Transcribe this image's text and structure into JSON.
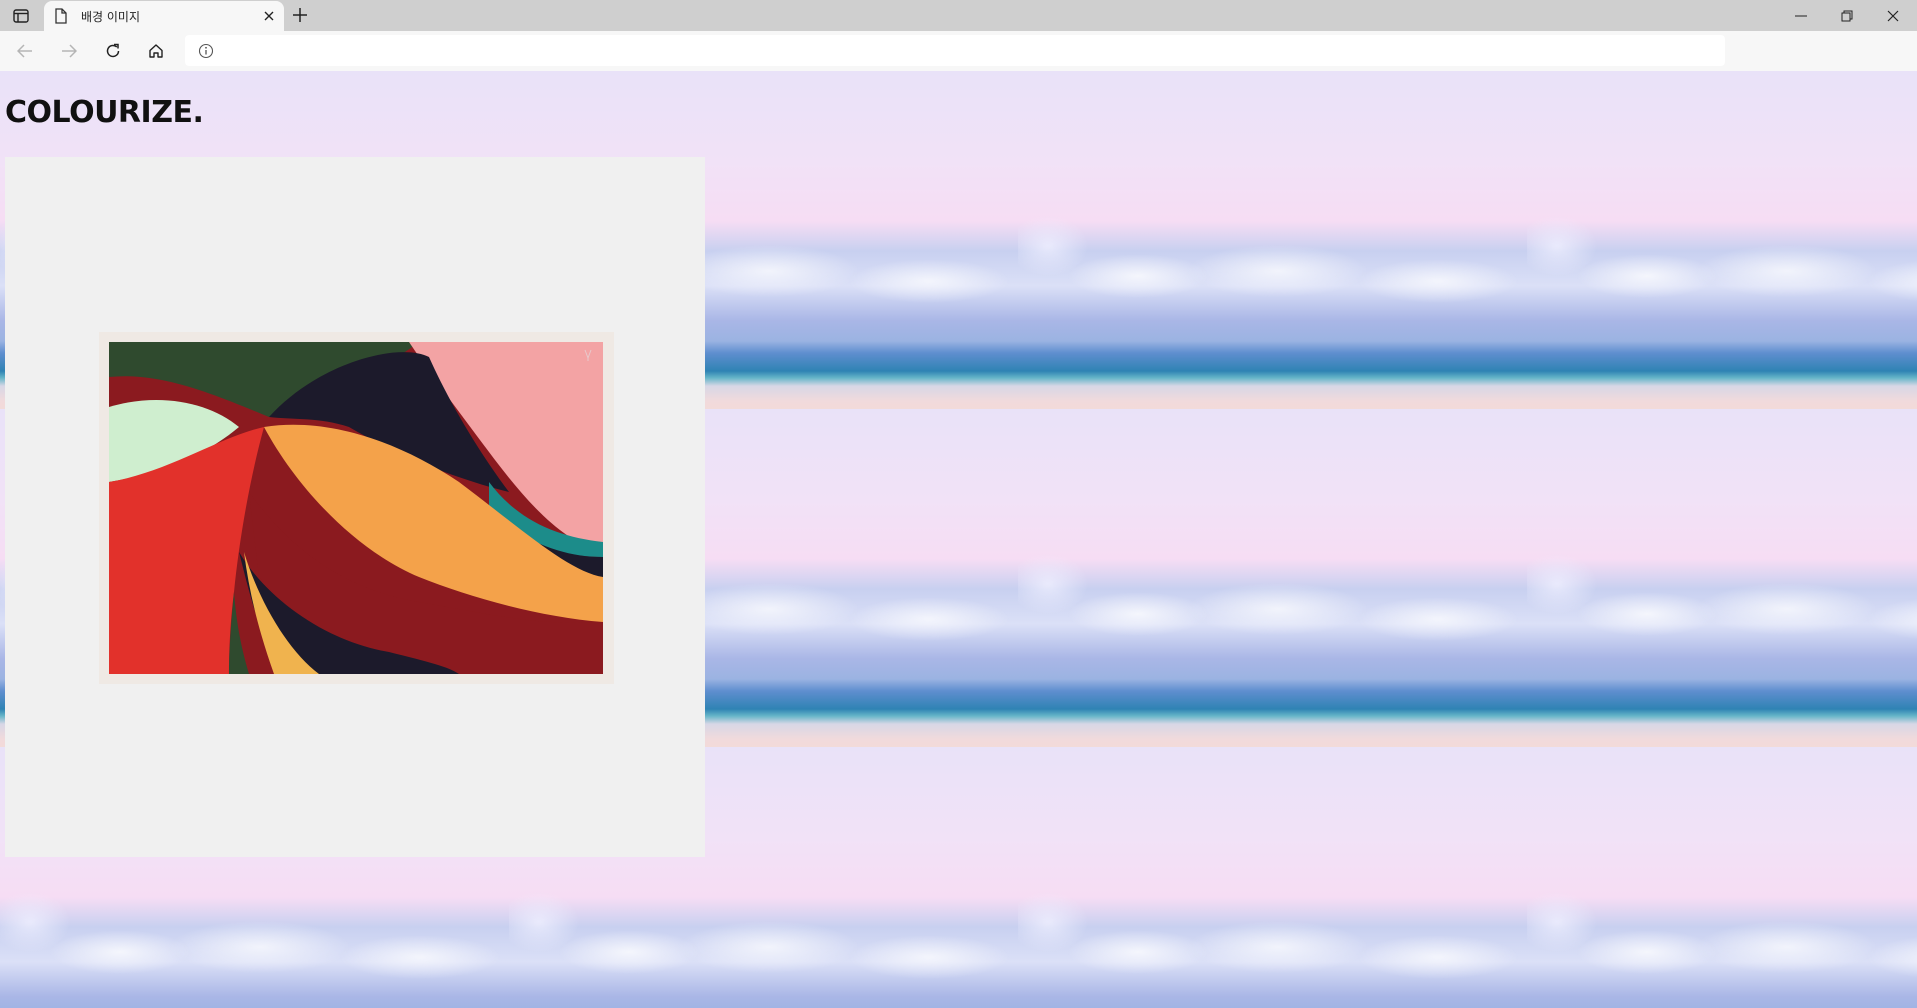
{
  "browser": {
    "tab_title": "배경 이미지",
    "address_value": ""
  },
  "page": {
    "headline": "COLOURIZE."
  },
  "icons": {
    "tab_actions": "tab-actions-icon",
    "page": "page-icon",
    "close_tab": "close-icon",
    "new_tab": "plus-icon",
    "back": "back-arrow-icon",
    "forward": "forward-arrow-icon",
    "reload": "reload-icon",
    "home": "home-icon",
    "site_info": "info-icon",
    "minimize": "minimize-icon",
    "restore": "restore-icon",
    "close_window": "close-window-icon"
  },
  "colors": {
    "painting_green": "#2f4a2e",
    "painting_red": "#e2312b",
    "painting_orange": "#f4a24a",
    "painting_pink": "#f3a3a4",
    "painting_maroon": "#8b1a1f",
    "painting_navy": "#1c1a2b",
    "painting_teal": "#1c8c8a",
    "painting_mint": "#cfeecf"
  }
}
